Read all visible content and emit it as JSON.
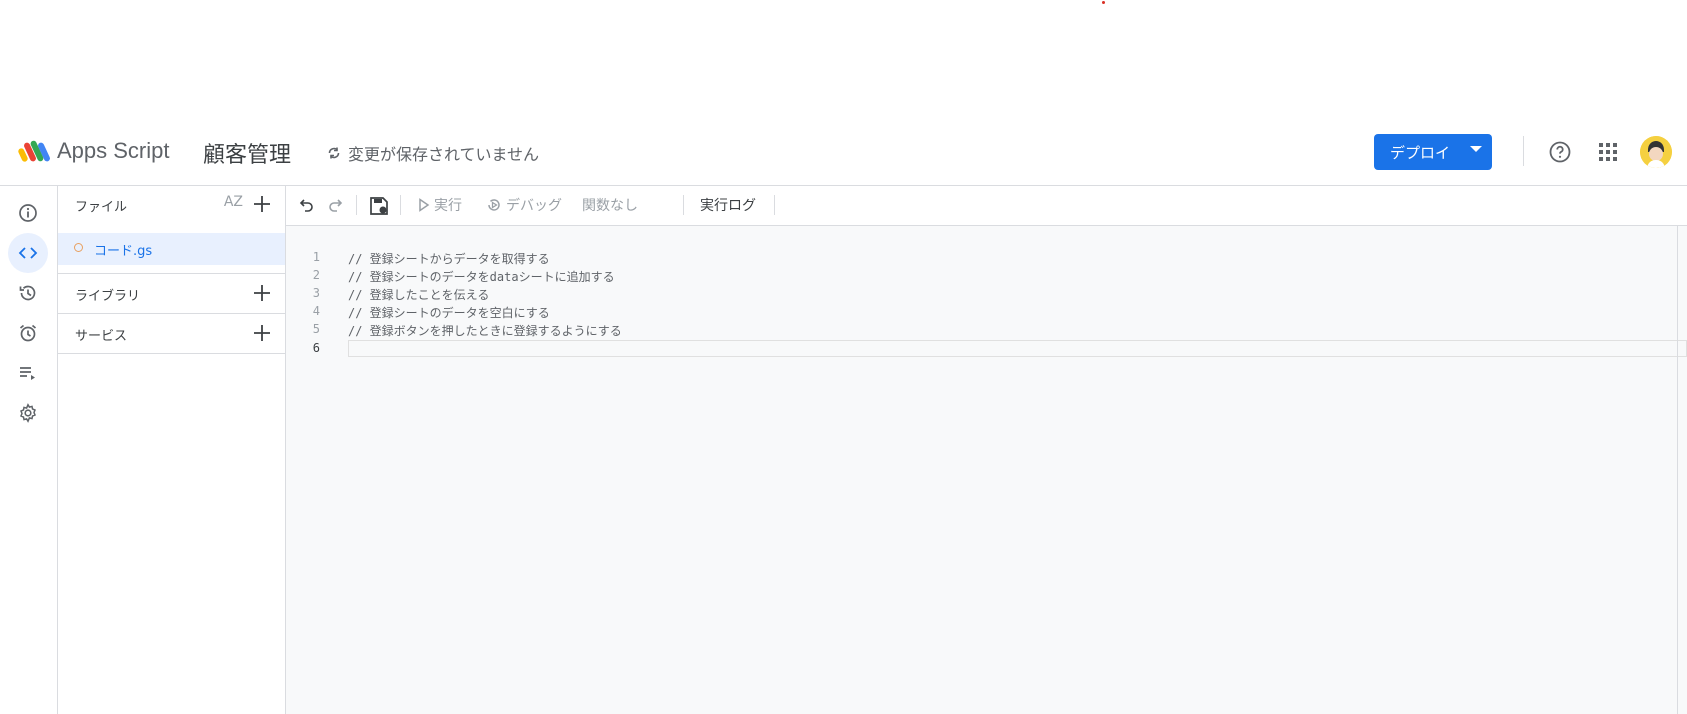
{
  "header": {
    "app_name": "Apps Script",
    "project_title": "顧客管理",
    "save_status": "変更が保存されていません",
    "deploy_label": "デプロイ"
  },
  "files_panel": {
    "files_label": "ファイル",
    "sort_label": "AZ",
    "file_name": "コード.gs",
    "libraries_label": "ライブラリ",
    "services_label": "サービス"
  },
  "toolbar": {
    "run_label": "実行",
    "debug_label": "デバッグ",
    "function_select": "関数なし",
    "exec_log_label": "実行ログ"
  },
  "editor": {
    "lines": [
      {
        "num": "1",
        "text": "// 登録シートからデータを取得する"
      },
      {
        "num": "2",
        "text": "// 登録シートのデータをdataシートに追加する"
      },
      {
        "num": "3",
        "text": "// 登録したことを伝える"
      },
      {
        "num": "4",
        "text": "// 登録シートのデータを空白にする"
      },
      {
        "num": "5",
        "text": "// 登録ボタンを押したときに登録するようにする"
      },
      {
        "num": "6",
        "text": ""
      }
    ]
  },
  "colors": {
    "accent": "#1a73e8",
    "selected_bg": "#e8f0fe",
    "editor_bg": "#f8f9fa"
  }
}
